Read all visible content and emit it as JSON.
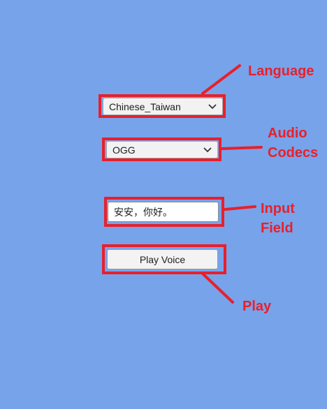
{
  "controls": {
    "language_value": "Chinese_Taiwan",
    "codec_value": "OGG",
    "input_value": "安安，你好。",
    "play_label": "Play Voice"
  },
  "annotations": {
    "language": "Language",
    "codecs_line1": "Audio",
    "codecs_line2": "Codecs",
    "input_line1": "Input",
    "input_line2": "Field",
    "play": "Play"
  },
  "colors": {
    "background": "#77a3eb",
    "annotation": "#e8202a"
  },
  "icons": {
    "dropdown_arrow": "chevron-down-icon"
  }
}
